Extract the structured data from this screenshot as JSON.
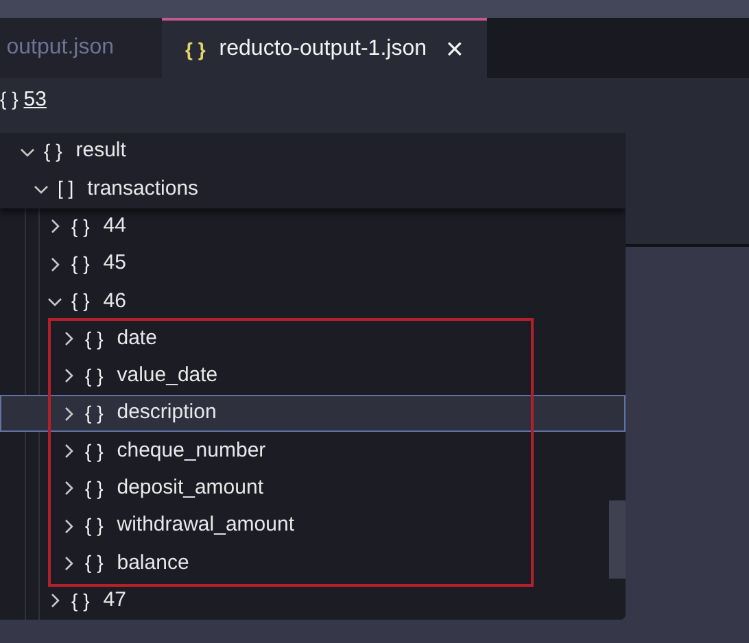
{
  "tabs": [
    {
      "label": "output.json",
      "selected": false
    },
    {
      "icon": "{ }",
      "label": "reducto-output-1.json",
      "close": "×",
      "selected": true
    }
  ],
  "breadcrumb": {
    "icon": "{ }",
    "label": "53"
  },
  "tree": [
    {
      "icon": "{ }",
      "label": "result",
      "expanded": true,
      "selected": false,
      "children": [
        {
          "icon": "[ ]",
          "label": "transactions",
          "expanded": true,
          "selected": false,
          "children": [
            {
              "icon": "{ }",
              "label": "44",
              "expanded": false,
              "selected": false
            },
            {
              "icon": "{ }",
              "label": "45",
              "expanded": false,
              "selected": false
            },
            {
              "icon": "{ }",
              "label": "46",
              "expanded": true,
              "selected": false,
              "children": [
                {
                  "icon": "{ }",
                  "label": "date",
                  "expanded": false,
                  "selected": false
                },
                {
                  "icon": "{ }",
                  "label": "value_date",
                  "expanded": false,
                  "selected": false
                },
                {
                  "icon": "{ }",
                  "label": "description",
                  "expanded": false,
                  "selected": true
                },
                {
                  "icon": "{ }",
                  "label": "cheque_number",
                  "expanded": false,
                  "selected": false
                },
                {
                  "icon": "{ }",
                  "label": "deposit_amount",
                  "expanded": false,
                  "selected": false
                },
                {
                  "icon": "{ }",
                  "label": "withdrawal_amount",
                  "expanded": false,
                  "selected": false
                },
                {
                  "icon": "{ }",
                  "label": "balance",
                  "expanded": false,
                  "selected": false
                }
              ]
            },
            {
              "icon": "{ }",
              "label": "47",
              "expanded": false,
              "selected": false
            }
          ]
        }
      ]
    }
  ]
}
